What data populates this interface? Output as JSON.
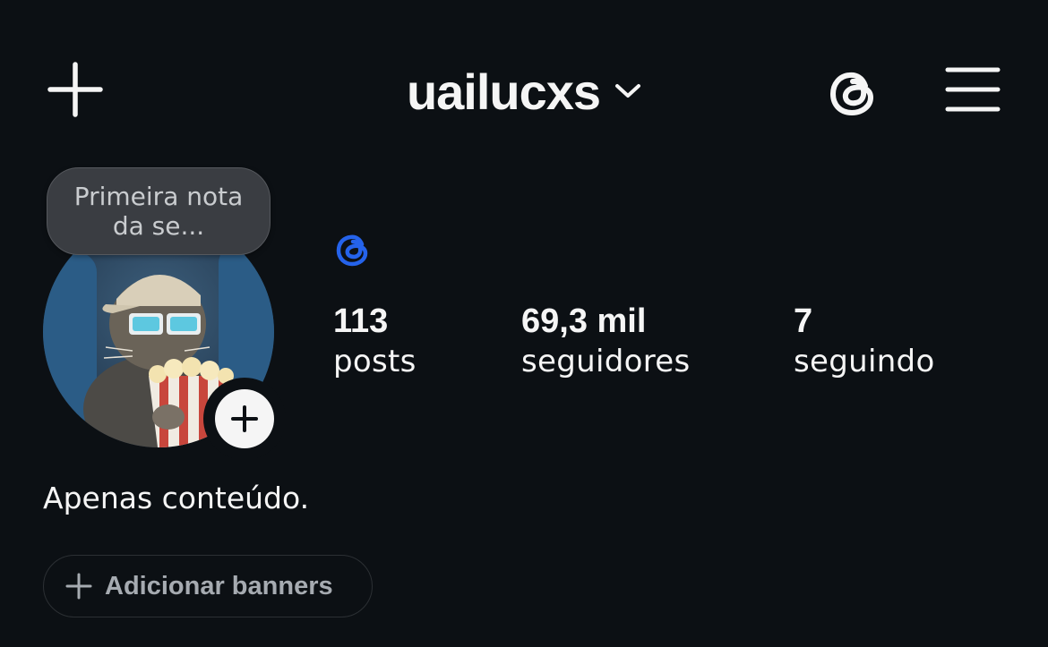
{
  "header": {
    "username": "uailucxs",
    "create_icon": "plus-icon",
    "dropdown_icon": "chevron-down-icon",
    "threads_icon": "threads-icon",
    "menu_icon": "hamburger-menu-icon"
  },
  "profile": {
    "note": "Primeira nota da se...",
    "add_story_icon": "plus-icon",
    "threads_badge_icon": "threads-badge-icon",
    "stats": [
      {
        "value": "113",
        "label": "posts"
      },
      {
        "value": "69,3 mil",
        "label": "seguidores"
      },
      {
        "value": "7",
        "label": "seguindo"
      }
    ],
    "bio": "Apenas conteúdo.",
    "add_banners_label": "Adicionar banners"
  },
  "colors": {
    "background": "#0c1014",
    "text_primary": "#f5f5f5",
    "note_bg": "#3a3d42",
    "threads_badge": "#2563eb",
    "button_text_muted": "#a6abb1"
  }
}
